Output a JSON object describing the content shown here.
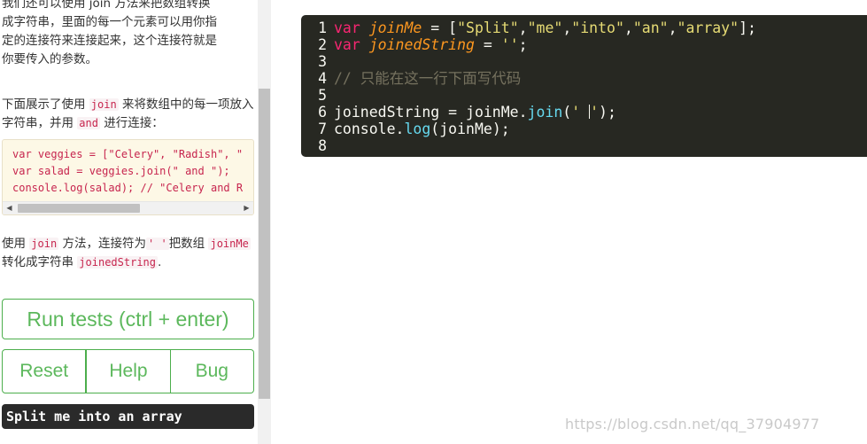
{
  "instructions": {
    "para1_lines": [
      "我们还可以使用 join 方法来把数组转换",
      "成字符串，里面的每一个元素可以用你指",
      "定的连接符来连接起来，这个连接符就是",
      "你要传入的参数。"
    ],
    "para2": {
      "text_a": "下面展示了使用 ",
      "code_join": "join",
      "text_b": " 来将数组中的每一项放入字符串，并用 ",
      "code_and": "and",
      "text_c": " 进行连接："
    },
    "example_code_lines": [
      "var veggies = [\"Celery\", \"Radish\", \"",
      "var salad = veggies.join(\" and \");",
      "console.log(salad); // \"Celery and R"
    ],
    "para3": {
      "text_a": "使用 ",
      "code_join": "join",
      "text_b": " 方法，连接符为",
      "code_sep": "' '",
      "text_c": "把数组 ",
      "code_joinMe": "joinMe",
      "text_d": " 转化成字符串 ",
      "code_joinedString": "joinedString",
      "text_e": "."
    }
  },
  "buttons": {
    "run": "Run tests (ctrl + enter)",
    "reset": "Reset",
    "help": "Help",
    "bug": "Bug"
  },
  "test_result": "Split me into an array",
  "editor": {
    "line_numbers": [
      "1",
      "2",
      "3",
      "4",
      "5",
      "6",
      "7",
      "8"
    ],
    "l1": {
      "kw": "var",
      "name": "joinMe",
      "op": " = [",
      "s1": "\"Split\"",
      "s2": "\"me\"",
      "s3": "\"into\"",
      "s4": "\"an\"",
      "s5": "\"array\"",
      "end": "];"
    },
    "l2": {
      "kw": "var",
      "name": "joinedString",
      "op": " = ",
      "str": "''",
      "end": ";"
    },
    "l4": {
      "comment": "// 只能在这一行下面写代码"
    },
    "l6": {
      "a": "joinedString = joinMe.",
      "fn": "join",
      "b": "(",
      "str_open": "' ",
      "str_close": "'",
      "c": ");"
    },
    "l7": {
      "a": "console.",
      "fn": "log",
      "b": "(joinMe);"
    }
  },
  "watermark": "https://blog.csdn.net/qq_37904977",
  "colors": {
    "editor_bg": "#272822",
    "keyword": "#f92672",
    "variable": "#fd971f",
    "string": "#e6db74",
    "function": "#66d9ef",
    "comment": "#75715e",
    "button_green": "#5cb85c"
  }
}
